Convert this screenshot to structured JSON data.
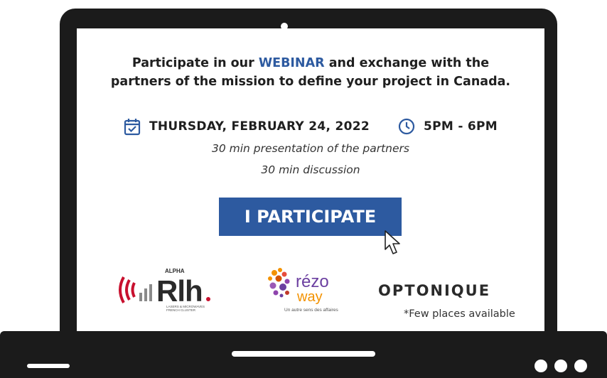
{
  "headline": {
    "line1_pre": "Participate in our ",
    "line1_highlight": "WEBINAR",
    "line1_post": " and exchange with the",
    "line2": "partners of the mission to define your project in Canada."
  },
  "event": {
    "date": "THURSDAY, FEBRUARY 24, 2022",
    "time": "5PM - 6PM",
    "date_icon": "calendar-check-icon",
    "time_icon": "clock-icon"
  },
  "agenda": {
    "line1": "30 min presentation of the partners",
    "line2": "30 min discussion"
  },
  "cta": {
    "label": "I PARTICIPATE"
  },
  "logos": {
    "rlh": {
      "small": "ALPHA",
      "main": "Rlh",
      "tag_line1": "LASERS & MICROWAVES",
      "tag_line2": "FRENCH CLUSTER"
    },
    "rezo": {
      "word1": "rézo",
      "word2": "way",
      "tagline": "Un autre sens des affaires"
    },
    "optonique": {
      "name": "OPTONIQUE"
    }
  },
  "note": "*Few places available",
  "colors": {
    "accent": "#2d5aa0",
    "frame": "#1b1b1b",
    "rlh_red": "#c8102e",
    "rezo_purple": "#6b3fa0",
    "rezo_orange": "#f39200"
  }
}
